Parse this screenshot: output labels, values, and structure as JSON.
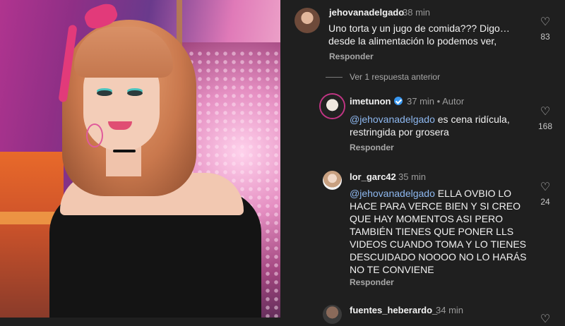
{
  "comments": [
    {
      "username": "jehovanadelgado",
      "time": "38 min",
      "text": "Uno torta y un jugo de comida??? Digo… desde la alimentación lo podemos ver,",
      "reply": "Responder",
      "likes": "83"
    },
    {
      "view_more": "Ver 1 respuesta anterior"
    },
    {
      "username": "imetunon",
      "time": "37 min",
      "author_tag": "• Autor",
      "mention": "@jehovanadelgado",
      "text": " es cena ridícula, restringida por grosera",
      "reply": "Responder",
      "likes": "168"
    },
    {
      "username": "lor_garc42",
      "time": "35 min",
      "mention": "@jehovanadelgado",
      "text": " ELLA OVBIO LO HACE PARA VERCE BIEN Y SI CREO QUE HAY MOMENTOS ASI PERO TAMBIÉN TIENES QUE PONER LLS VIDEOS CUANDO TOMA Y LO TIENES DESCUIDADO NOOOO NO LO HARÁS NO TE CONVIENE",
      "reply": "Responder",
      "likes": "24"
    },
    {
      "username": "fuentes_heberardo_",
      "time": "34 min"
    }
  ],
  "icons": {
    "like": "heart-outline-icon",
    "verified": "verified-badge-icon"
  },
  "colors": {
    "background": "#1f1f1f",
    "mention": "#8eb8f0",
    "verified": "#3897f0"
  }
}
